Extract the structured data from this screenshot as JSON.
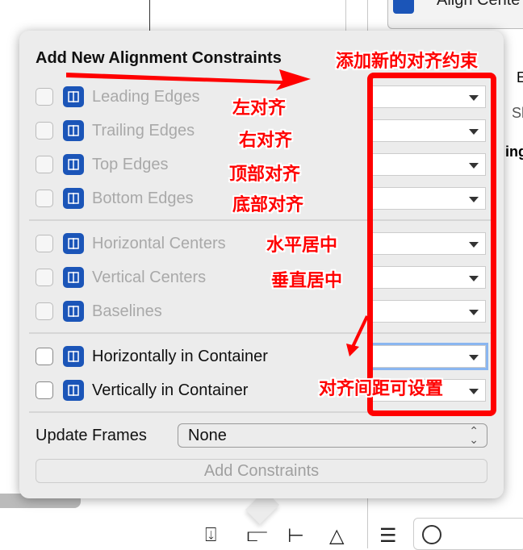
{
  "background": {
    "right_panel_labels": [
      "Align Cente",
      "E",
      "Sh",
      "ing"
    ]
  },
  "popover": {
    "title": "Add New Alignment Constraints",
    "rows": [
      {
        "label": "Leading Edges",
        "enabled": false,
        "icon": "align-leading-icon"
      },
      {
        "label": "Trailing Edges",
        "enabled": false,
        "icon": "align-trailing-icon"
      },
      {
        "label": "Top Edges",
        "enabled": false,
        "icon": "align-top-icon"
      },
      {
        "label": "Bottom Edges",
        "enabled": false,
        "icon": "align-bottom-icon"
      },
      {
        "label": "Horizontal Centers",
        "enabled": false,
        "icon": "align-hcenter-icon"
      },
      {
        "label": "Vertical Centers",
        "enabled": false,
        "icon": "align-vcenter-icon"
      },
      {
        "label": "Baselines",
        "enabled": false,
        "icon": "align-baseline-icon"
      },
      {
        "label": "Horizontally in Container",
        "enabled": true,
        "icon": "align-hcontainer-icon"
      },
      {
        "label": "Vertically in Container",
        "enabled": true,
        "icon": "align-vcontainer-icon"
      }
    ],
    "update_frames_label": "Update Frames",
    "update_frames_value": "None",
    "add_button": "Add Constraints"
  },
  "annotations": [
    "添加新的对齐约束",
    "左对齐",
    "右对齐",
    "顶部对齐",
    "底部对齐",
    "水平居中",
    "垂直居中",
    "对齐间距可设置"
  ],
  "colors": {
    "annotation": "#ff0000",
    "icon": "#1b55b8"
  }
}
